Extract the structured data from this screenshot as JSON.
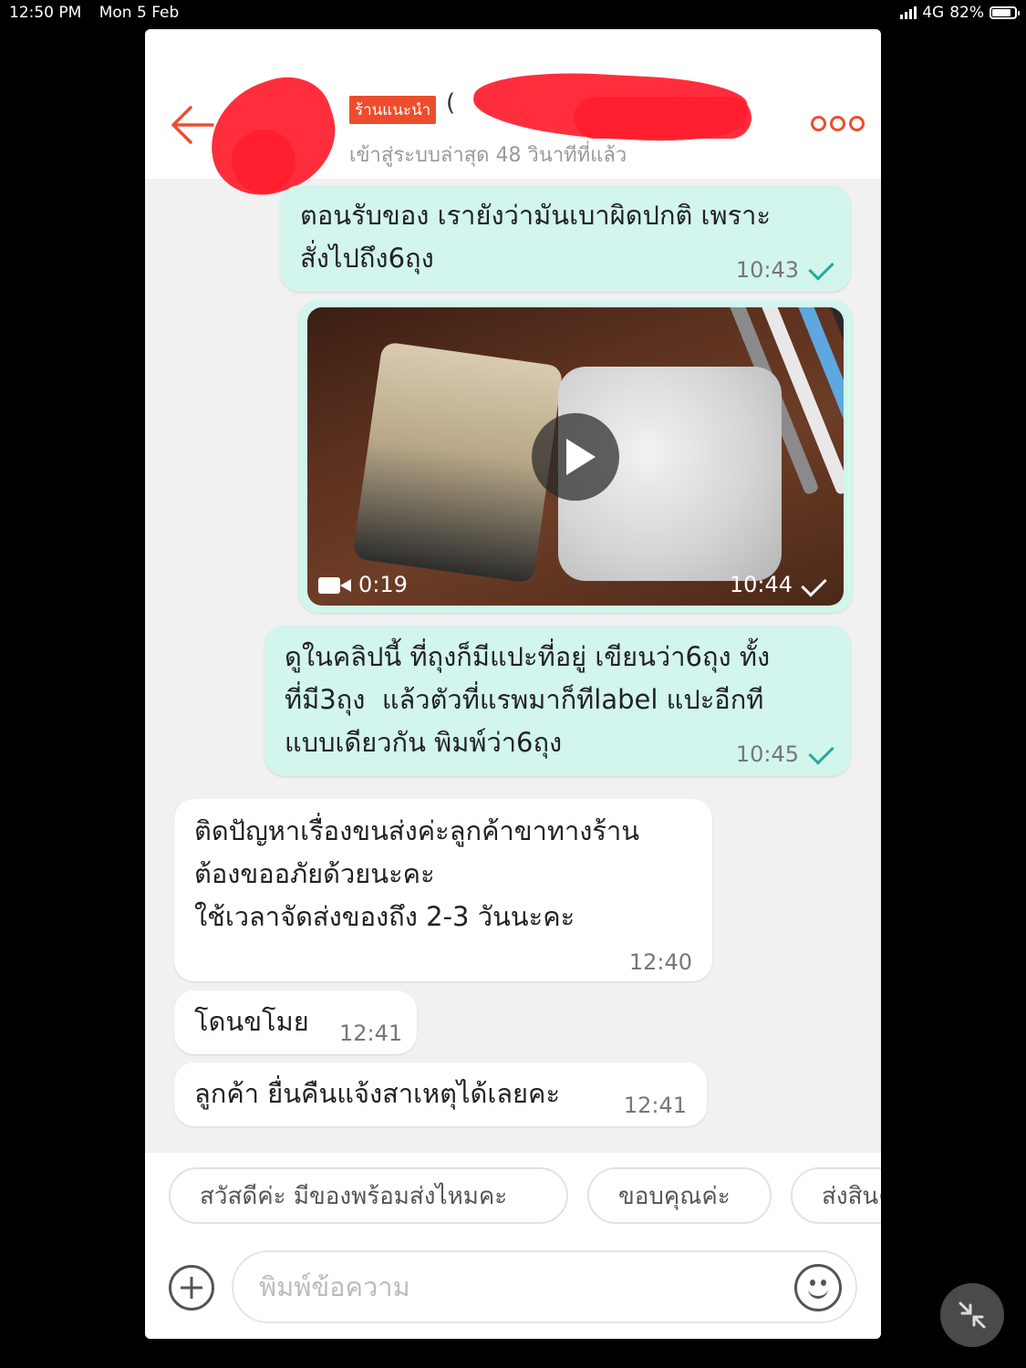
{
  "status_bar": {
    "time": "12:50 PM",
    "date": "Mon 5 Feb",
    "network": "4G",
    "battery": "82%",
    "battery_level": 0.82
  },
  "header": {
    "shop_tag": "ร้านแนะนำ",
    "shop_name_visible": "(",
    "last_seen": "เข้าสู่ระบบล่าสุด 48 วินาทีที่แล้ว",
    "icons": {
      "back": "back-arrow-icon",
      "more": "more-dots-icon"
    },
    "accent_color": "#ee4d2d"
  },
  "messages": [
    {
      "side": "out",
      "text": "ตอนรับของ เรายังว่ามันเบาผิดปกติ เพราะ\nสั่งไปถึง6ถุง",
      "time": "10:43",
      "read": true
    },
    {
      "side": "out",
      "type": "video",
      "duration": "0:19",
      "time": "10:44",
      "read": true
    },
    {
      "side": "out",
      "text": "ดูในคลิปนี้ ที่ถุงก็มีแปะที่อยู่ เขียนว่า6ถุง ทั้ง\nที่มี3ถุง  แล้วตัวที่แรพมาก็ทีlabel แปะอีกที\nแบบเดียวกัน พิมพ์ว่า6ถุง",
      "time": "10:45",
      "read": true
    },
    {
      "side": "in",
      "text": "ติดปัญหาเรื่องขนส่งค่ะลูกค้าขาทางร้าน\nต้องขออภัยด้วยนะคะ\nใช้เวลาจัดส่งของถึง 2-3 วันนะคะ",
      "time": "12:40"
    },
    {
      "side": "in",
      "text": "โดนขโมย",
      "time": "12:41"
    },
    {
      "side": "in",
      "text": "ลูกค้า ยื่นคืนแจ้งสาเหตุได้เลยคะ",
      "time": "12:41"
    }
  ],
  "quick_replies": [
    "สวัสดีค่ะ มีของพร้อมส่งไหมคะ",
    "ขอบคุณค่ะ",
    "ส่งสินค้า"
  ],
  "input": {
    "placeholder": "พิมพ์ข้อความ"
  },
  "colors": {
    "outgoing_bubble": "#d2f5ee",
    "incoming_bubble": "#ffffff",
    "read_tick": "#26aa99"
  }
}
